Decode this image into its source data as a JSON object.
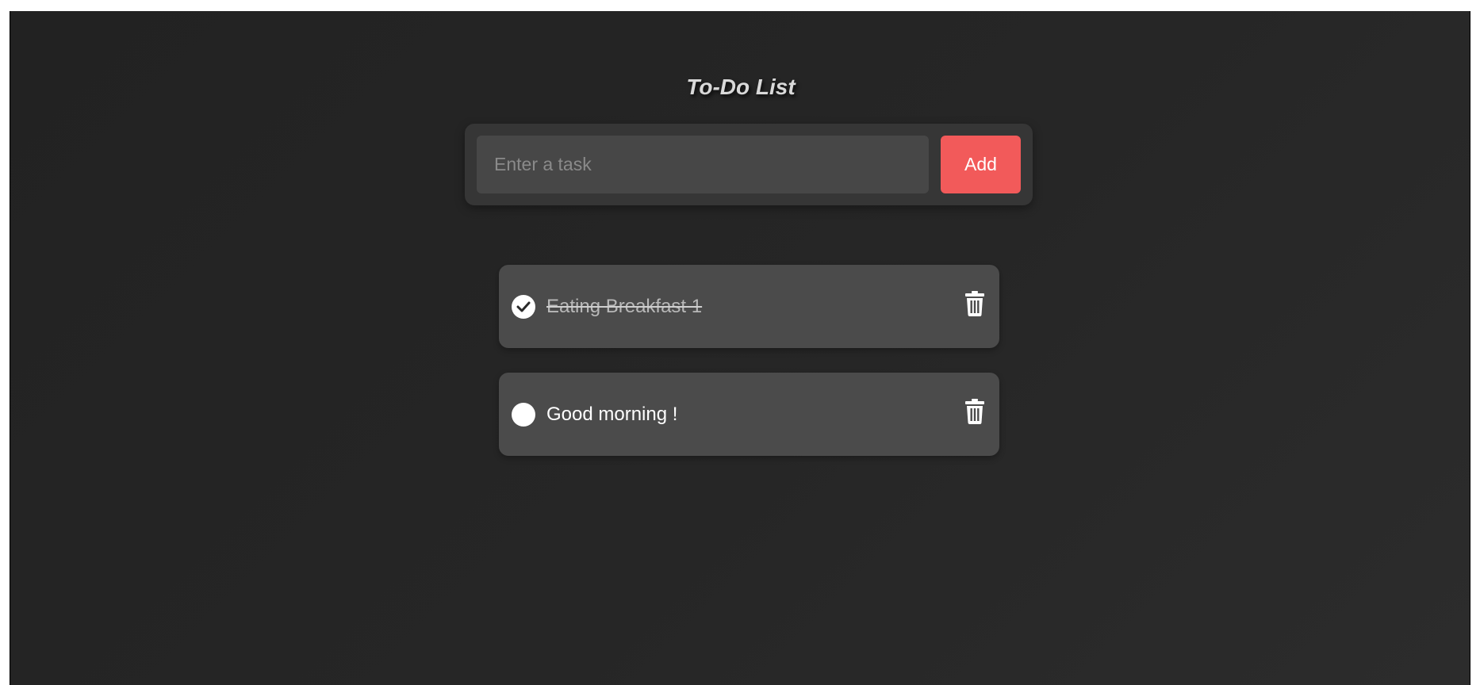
{
  "app": {
    "title": "To-Do List"
  },
  "input": {
    "placeholder": "Enter a task",
    "value": ""
  },
  "add_button": {
    "label": "Add"
  },
  "tasks": [
    {
      "text": "Eating Breakfast 1",
      "completed": true,
      "check_icon": "check-icon",
      "delete_icon": "trash-icon"
    },
    {
      "text": "Good morning !",
      "completed": false,
      "check_icon": "circle-icon",
      "delete_icon": "trash-icon"
    }
  ],
  "colors": {
    "background": "#242424",
    "panel": "#363636",
    "input_bg": "#474747",
    "task_bg": "#4b4b4b",
    "accent": "#f25a5a",
    "text": "#ffffff",
    "title": "#d9d9d9"
  }
}
